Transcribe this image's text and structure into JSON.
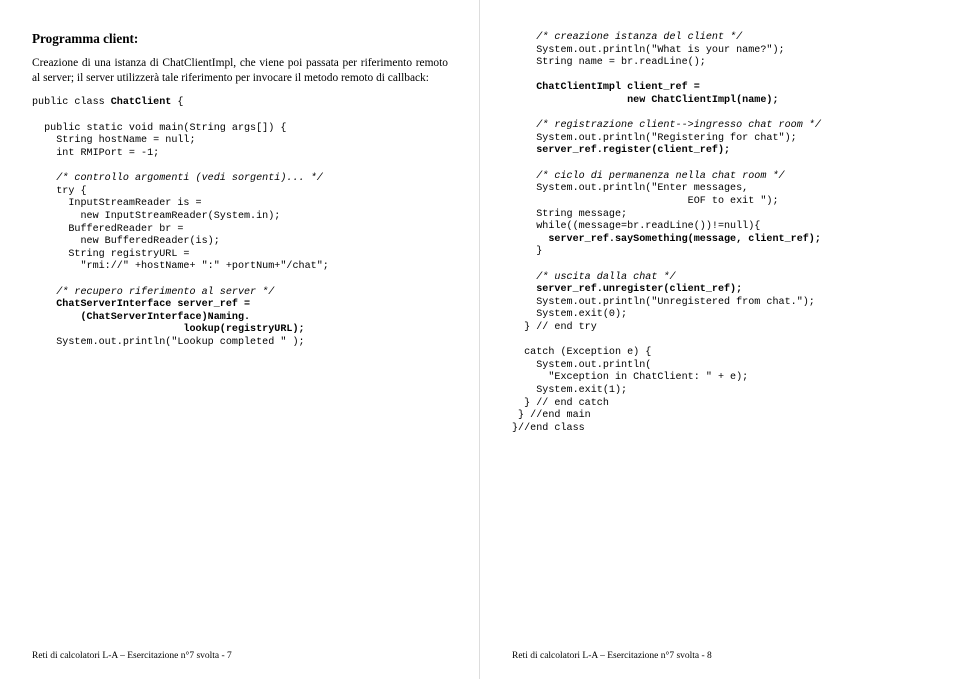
{
  "left": {
    "heading": "Programma client:",
    "paragraph": "Creazione di una istanza di ChatClientImpl, che viene poi passata per riferimento remoto al server; il server utilizzerà tale riferimento per invocare il metodo remoto di callback:",
    "code": {
      "l1a": "public class ",
      "l1b": "ChatClient",
      "l1c": " {",
      "l2": "  public static void main(String args[]) {",
      "l3": "    String hostName = null;",
      "l4": "    int RMIPort = -1;",
      "l5": "    /* controllo argomenti (vedi sorgenti)... */",
      "l6": "    try {",
      "l7": "      InputStreamReader is =",
      "l8": "        new InputStreamReader(System.in);",
      "l9": "      BufferedReader br =",
      "l10": "        new BufferedReader(is);",
      "l11": "      String registryURL =",
      "l12": "        \"rmi://\" +hostName+ \":\" +portNum+\"/chat\";",
      "l13": "    /* recupero riferimento al server */",
      "l14": "    ChatServerInterface server_ref =",
      "l15": "        (ChatServerInterface)Naming.",
      "l16": "                         lookup(registryURL);",
      "l17": "    System.out.println(\"Lookup completed \" );"
    },
    "footer": "Reti di calcolatori L-A – Esercitazione n°7 svolta  -  7"
  },
  "right": {
    "code": {
      "l1": "    /* creazione istanza del client */",
      "l2": "    System.out.println(\"What is your name?\");",
      "l3": "    String name = br.readLine();",
      "l4": "    ChatClientImpl client_ref =",
      "l5": "                   new ChatClientImpl(name);",
      "l6": "    /* registrazione client-->ingresso chat room */",
      "l7": "    System.out.println(\"Registering for chat\");",
      "l8": "    server_ref.register(client_ref);",
      "l9": "    /* ciclo di permanenza nella chat room */",
      "l10": "    System.out.println(\"Enter messages,",
      "l11": "                             EOF to exit \");",
      "l12": "    String message;",
      "l13": "    while((message=br.readLine())!=null){",
      "l14": "      server_ref.saySomething(message, client_ref);",
      "l15": "    }",
      "l16": "    /* uscita dalla chat */",
      "l17": "    server_ref.unregister(client_ref);",
      "l18": "    System.out.println(\"Unregistered from chat.\");",
      "l19": "    System.exit(0);",
      "l20": "  } // end try",
      "l21": "  catch (Exception e) {",
      "l22": "    System.out.println(",
      "l23": "      \"Exception in ChatClient: \" + e);",
      "l24": "    System.exit(1);",
      "l25": "  } // end catch",
      "l26": " } //end main",
      "l27": "}//end class"
    },
    "footer": "Reti di calcolatori L-A – Esercitazione n°7 svolta  -  8"
  }
}
